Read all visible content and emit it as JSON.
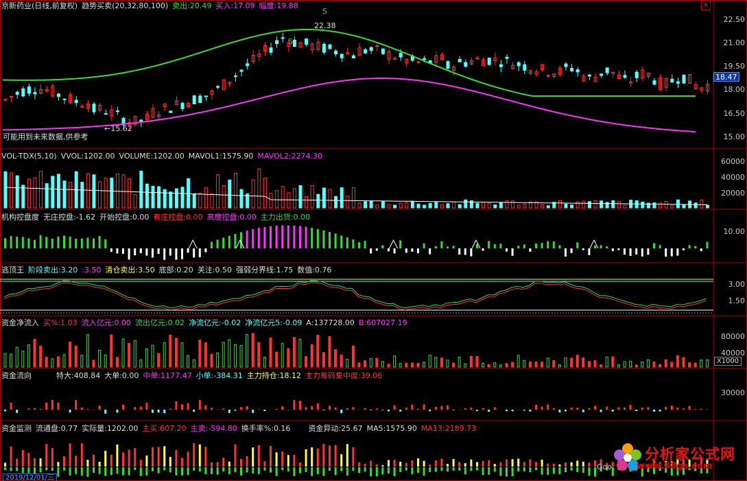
{
  "window": {
    "close_label": "×"
  },
  "main": {
    "stock": "京新药业(日线,前复权)",
    "indicator": "趋势买卖(20,32,80,100)",
    "sell_label": "卖出:20.49",
    "buy_label": "买入:17.09",
    "range_label": "幅度:19.88",
    "note": "可能用到未来数据,供参考",
    "high_label": "22.38",
    "low_label": "←15.62",
    "s_marker": "S",
    "x_marker": "x",
    "current_price": "18.47",
    "axis": [
      "22.50",
      "21.00",
      "19.50",
      "18.00",
      "16.50",
      "15.00"
    ]
  },
  "vol": {
    "name": "VOL-TDX(5,10)",
    "vvol": "VVOL:1202.00",
    "volume": "VOLUME:1202.00",
    "mavol1": "MAVOL1:1575.90",
    "mavol2": "MAVOL2:2274.30",
    "axis": [
      "60000",
      "40000",
      "20000"
    ]
  },
  "jigou": {
    "name": "机构控盘度",
    "wuzhuang": "无庄控盘:-1.62",
    "kaishi": "开始控盘:0.00",
    "youzhuang": "有庄控盘:0.00",
    "gaodu": "高度控盘:0.00",
    "zhuli": "主力出货:0.00",
    "axis": [
      "10.00"
    ]
  },
  "taoding": {
    "name": "逃顶王",
    "jieduan": "阶段卖出:3.20",
    "jieduan2": ":3.50",
    "qingcang": "清仓卖出:3.50",
    "dibu": "底部:0.20",
    "guanzhu": "关注:0.50",
    "qiangruo": "强弱分界线:1.75",
    "shuzhi": "数值:0.76",
    "axis": [
      "3.00",
      "1.50"
    ]
  },
  "jingliu": {
    "name": "资金净流入",
    "mai": "买%:1.03",
    "liuru": "流入亿元:0.00",
    "liuchu": "流出亿元:0.02",
    "jingliu": "净流亿元:-0.02",
    "jingliu5": "净流亿元5:-0.09",
    "a": "A:137728.00",
    "b": "B:607027.19",
    "axis": [
      "80000",
      "40000"
    ],
    "unit": "X1000"
  },
  "liuxiang": {
    "name": "资金流向",
    "teda": "特大:408.84",
    "dadan": "大单:0.00",
    "zhongdan": "中单:1177.47",
    "xiaodan": "小单:-384.31",
    "zhuli": "主力持仓:18.12",
    "jizhong": "主力筹码集中度:39.06",
    "axis": [
      "30000"
    ]
  },
  "jiance": {
    "name": "资金监测",
    "liutong": "流通盘:0.77",
    "shiji": "实际量:1202.00",
    "zhumai": "主买:607.20",
    "zhumai2": "主卖:-594.80",
    "huanshou": "换手率%:0.16",
    "yidong": "资金异动:25.67",
    "ma5": "MA5:1575.90",
    "ma13": "MA13:2189.73"
  },
  "date": "2019/12/01/三",
  "watermark": {
    "big": "分析家公式网",
    "small": "www.88gs.com",
    "g": "Goo"
  },
  "colors": {
    "up": "#ff3333",
    "down": "#55ffff",
    "green": "#33dd33",
    "magenta": "#ff33ff",
    "yellow": "#ffff33"
  }
}
